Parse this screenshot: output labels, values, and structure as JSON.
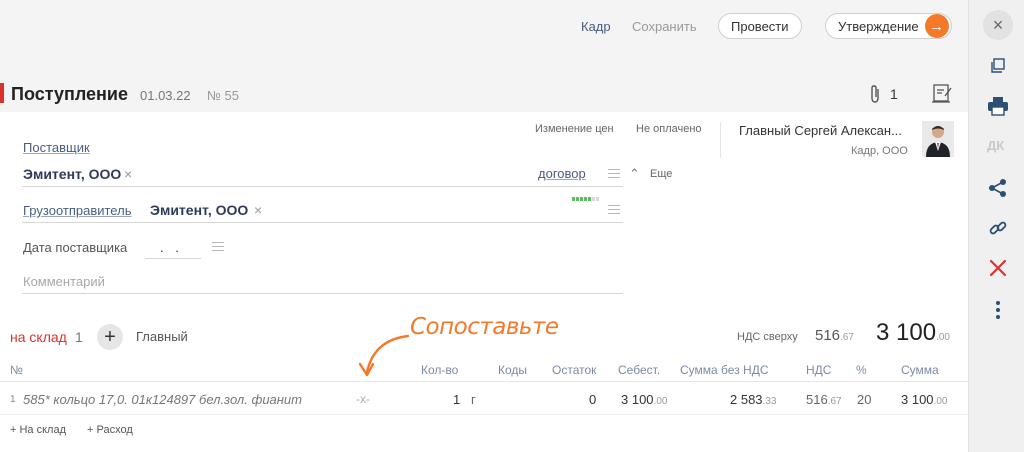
{
  "toolbar": {
    "frame_label": "Кадр",
    "save_label": "Сохранить",
    "post_label": "Провести",
    "approve_label": "Утверждение"
  },
  "header": {
    "title": "Поступление",
    "date": "01.03.22",
    "number_label": "№ 55",
    "attachments_count": "1"
  },
  "status": {
    "price_change": "Изменение цен",
    "payment": "Не оплачено"
  },
  "responsible": {
    "name": "Главный Сергей Алексан...",
    "org": "Кадр, ООО"
  },
  "form": {
    "supplier_label": "Поставщик",
    "supplier_value": "Эмитент, ООО",
    "contract_link": "договор",
    "more_label": "Еще",
    "shipper_label": "Грузоотправитель",
    "shipper_value": "Эмитент, ООО",
    "supplier_date_label": "Дата поставщика",
    "supplier_date_value": ". .",
    "comment_placeholder": "Комментарий"
  },
  "warehouse": {
    "label": "на склад",
    "count": "1",
    "name": "Главный"
  },
  "totals": {
    "vat_label": "НДС сверху",
    "vat_int": "516",
    "vat_frac": ".67",
    "total_int": "3 100",
    "total_frac": ".00"
  },
  "annotation": {
    "text": "Сопоставьте"
  },
  "table": {
    "columns": [
      "№",
      "Кол-во",
      "Коды",
      "Остаток",
      "Себест.",
      "Сумма без НДС",
      "НДС",
      "%",
      "Сумма"
    ],
    "rows": [
      {
        "num": "1",
        "name": "585* кольцо 17,0. 01к124897 бел.зол. фианит",
        "match": "-x-",
        "qty": "1",
        "unit": "г",
        "stock": "0",
        "cost_int": "3 100",
        "cost_frac": ".00",
        "net_int": "2 583",
        "net_frac": ".33",
        "vat_int": "516",
        "vat_frac": ".67",
        "vat_pct": "20",
        "sum_int": "3 100",
        "sum_frac": ".00"
      }
    ]
  },
  "footer": {
    "to_warehouse": "+ На склад",
    "expense": "+ Расход"
  },
  "sidebar": {
    "doc_label": "ДК"
  },
  "colors": {
    "accent": "#f47a2a",
    "link": "#4a5d80",
    "danger": "#e0312f",
    "title_marker": "#d9342b"
  }
}
